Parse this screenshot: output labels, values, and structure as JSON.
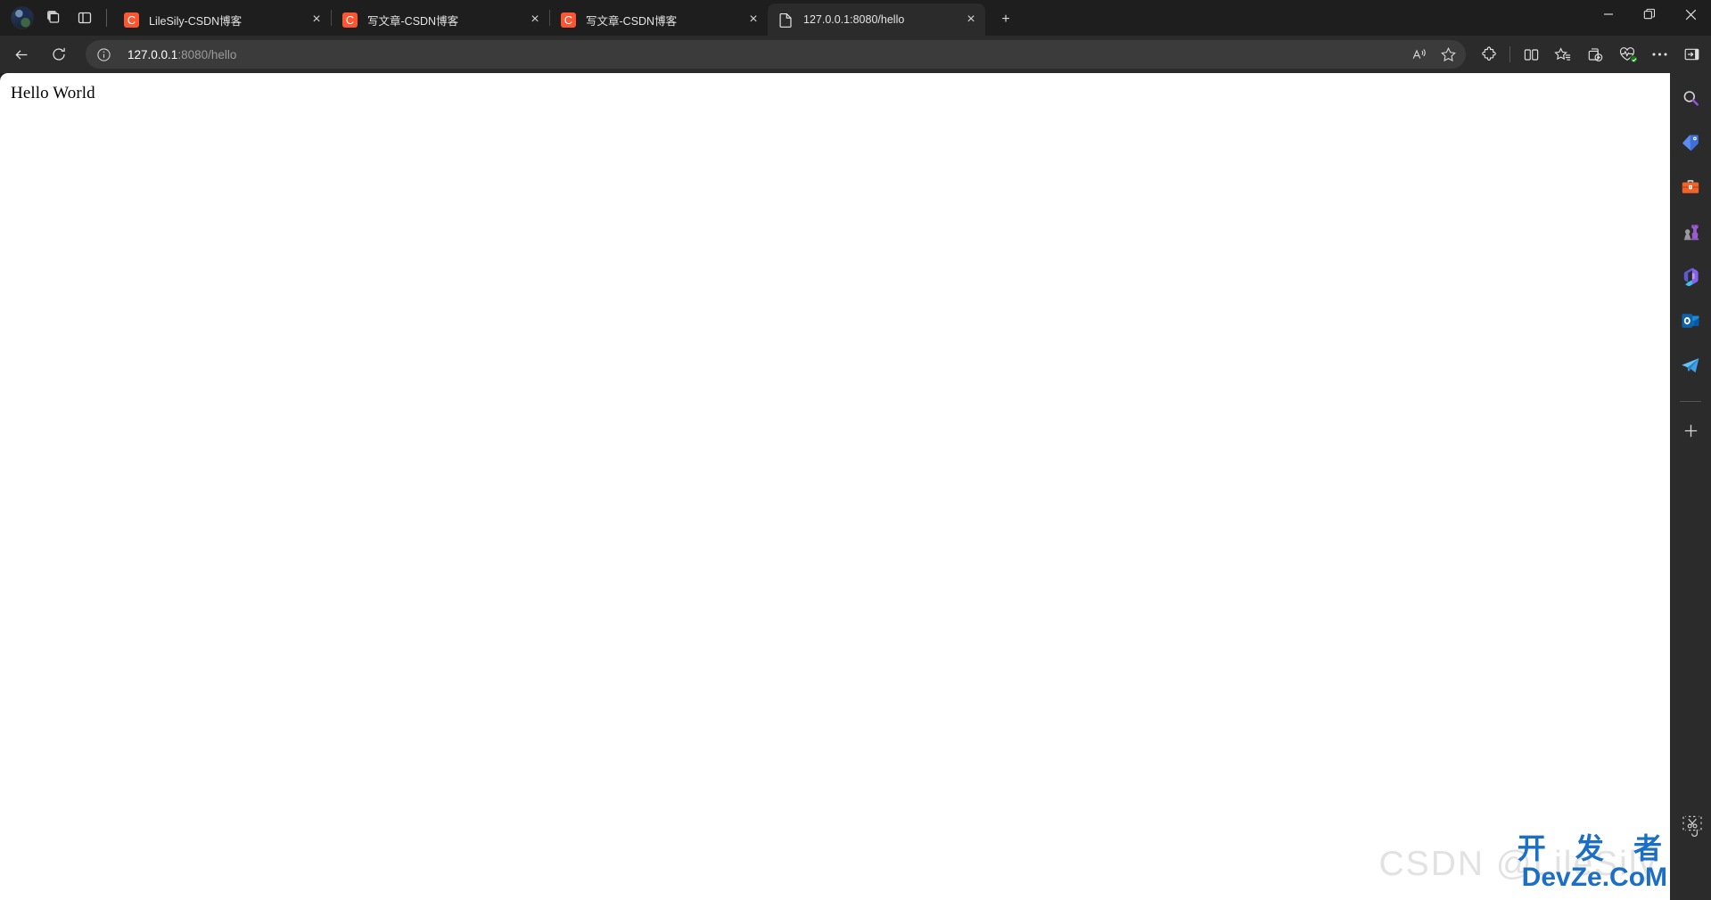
{
  "window": {
    "minimize_label": "Minimize",
    "restore_label": "Restore",
    "close_label": "Close"
  },
  "tabstrip": {
    "avatar_name": "profile-avatar",
    "workspaces_label": "Workspaces",
    "tab_actions_label": "Tab actions menu",
    "new_tab_label": "+",
    "tabs": [
      {
        "title": "LileSily-CSDN博客",
        "favicon": "csdn-icon",
        "favicon_letter": "C",
        "active": false,
        "close_label": "×"
      },
      {
        "title": "写文章-CSDN博客",
        "favicon": "csdn-icon",
        "favicon_letter": "C",
        "active": false,
        "close_label": "×"
      },
      {
        "title": "写文章-CSDN博客",
        "favicon": "csdn-icon",
        "favicon_letter": "C",
        "active": false,
        "close_label": "×"
      },
      {
        "title": "127.0.0.1:8080/hello",
        "favicon": "page-icon",
        "favicon_letter": "",
        "active": true,
        "close_label": "×"
      }
    ]
  },
  "toolbar": {
    "back_label": "Back",
    "refresh_label": "Refresh",
    "site_info_label": "View site information",
    "url_host": "127.0.0.1",
    "url_rest": ":8080/hello",
    "url_full": "127.0.0.1:8080/hello",
    "read_aloud_label": "Read aloud",
    "favorite_label": "Add this page to favorites",
    "extensions_label": "Extensions",
    "split_screen_label": "Split screen",
    "collections_label": "Collections",
    "add_to_collection_label": "Add to collections",
    "browser_essentials_label": "Browser essentials",
    "settings_more_label": "Settings and more",
    "sidebar_toggle_label": "Toggle sidebar"
  },
  "page": {
    "body_text": "Hello World",
    "background": "#ffffff"
  },
  "sidebar": {
    "items": [
      {
        "name": "search-icon",
        "label": "Search"
      },
      {
        "name": "shopping-tag-icon",
        "label": "Shopping"
      },
      {
        "name": "tools-icon",
        "label": "Tools"
      },
      {
        "name": "games-icon",
        "label": "Games"
      },
      {
        "name": "microsoft-365-icon",
        "label": "Microsoft 365"
      },
      {
        "name": "outlook-icon",
        "label": "Outlook"
      },
      {
        "name": "telegram-icon",
        "label": "Telegram"
      }
    ],
    "add_label": "+",
    "add_name": "customize-sidebar-button"
  },
  "watermarks": {
    "csdn": "CSDN @LileSily",
    "devze_cn": "开 发 者",
    "devze_en": "DevZe.CoM",
    "accent_color": "#1b6fc4"
  },
  "colors": {
    "tabstrip_bg": "#1e1e1e",
    "toolbar_bg": "#2b2b2b",
    "active_tab_bg": "#2b2b2b",
    "omnibox_bg": "#3b3b3b",
    "csdn_orange": "#fc5531",
    "page_bg": "#ffffff"
  }
}
